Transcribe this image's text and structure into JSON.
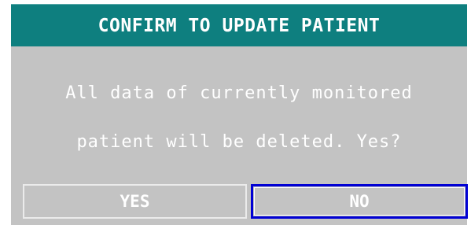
{
  "dialog": {
    "title": "CONFIRM TO UPDATE PATIENT",
    "message_lines": [
      "All data of currently monitored",
      "patient will be deleted. Yes?"
    ],
    "buttons": {
      "yes_label": "YES",
      "no_label": "NO",
      "focused": "NO"
    }
  },
  "colors": {
    "title_bar": "#0e7f7f",
    "dialog_background": "#c3c3c3",
    "text": "#ffffff",
    "focus_border": "#0000d4"
  }
}
